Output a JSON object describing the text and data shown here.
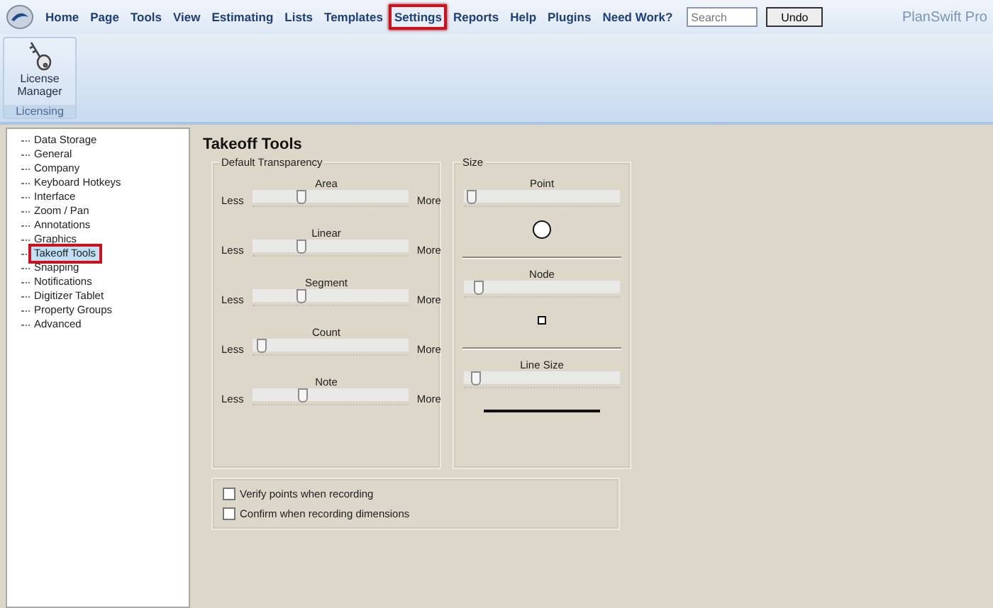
{
  "menu": [
    {
      "label": "Home",
      "selected": false
    },
    {
      "label": "Page",
      "selected": false
    },
    {
      "label": "Tools",
      "selected": false
    },
    {
      "label": "View",
      "selected": false
    },
    {
      "label": "Estimating",
      "selected": false
    },
    {
      "label": "Lists",
      "selected": false
    },
    {
      "label": "Templates",
      "selected": false
    },
    {
      "label": "Settings",
      "selected": true
    },
    {
      "label": "Reports",
      "selected": false
    },
    {
      "label": "Help",
      "selected": false
    },
    {
      "label": "Plugins",
      "selected": false
    },
    {
      "label": "Need Work?",
      "selected": false
    }
  ],
  "search": {
    "placeholder": "Search"
  },
  "undo": "Undo",
  "brand": "PlanSwift Pro",
  "ribbon": {
    "button_lines": [
      "License",
      "Manager"
    ],
    "group": "Licensing"
  },
  "tree": [
    {
      "label": "Data Storage",
      "selected": false
    },
    {
      "label": "General",
      "selected": false
    },
    {
      "label": "Company",
      "selected": false
    },
    {
      "label": "Keyboard Hotkeys",
      "selected": false
    },
    {
      "label": "Interface",
      "selected": false
    },
    {
      "label": "Zoom / Pan",
      "selected": false
    },
    {
      "label": "Annotations",
      "selected": false
    },
    {
      "label": "Graphics",
      "selected": false
    },
    {
      "label": "Takeoff Tools",
      "selected": true
    },
    {
      "label": "Snapping",
      "selected": false
    },
    {
      "label": "Notifications",
      "selected": false
    },
    {
      "label": "Digitizer Tablet",
      "selected": false
    },
    {
      "label": "Property Groups",
      "selected": false
    },
    {
      "label": "Advanced",
      "selected": false
    }
  ],
  "heading": "Takeoff Tools",
  "transparency": {
    "title": "Default Transparency",
    "sliders": [
      {
        "label": "Area",
        "min_label": "Less",
        "max_label": "More",
        "level": 0.3
      },
      {
        "label": "Linear",
        "min_label": "Less",
        "max_label": "More",
        "level": 0.3
      },
      {
        "label": "Segment",
        "min_label": "Less",
        "max_label": "More",
        "level": 0.3
      },
      {
        "label": "Count",
        "min_label": "Less",
        "max_label": "More",
        "level": 0.03
      },
      {
        "label": "Note",
        "min_label": "Less",
        "max_label": "More",
        "level": 0.31
      }
    ]
  },
  "size": {
    "title": "Size",
    "sliders": [
      {
        "label": "Point",
        "kind": "circle",
        "level": 0.02
      },
      {
        "label": "Node",
        "kind": "square",
        "level": 0.07
      },
      {
        "label": "Line Size",
        "kind": "line",
        "level": 0.05
      }
    ]
  },
  "options": [
    {
      "label": "Verify points when recording",
      "checked": false
    },
    {
      "label": "Confirm when recording dimensions",
      "checked": false
    }
  ]
}
